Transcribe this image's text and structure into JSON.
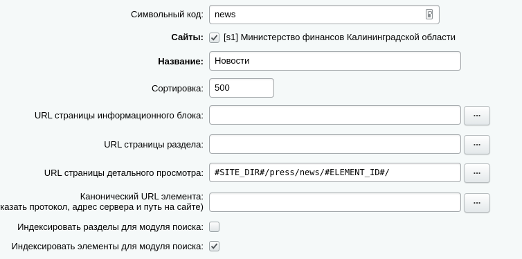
{
  "form": {
    "code": {
      "label": "Символьный код:",
      "value": "news"
    },
    "sites": {
      "label": "Сайты:",
      "checked": true,
      "option": "[s1] Министерство финансов Калининградской области"
    },
    "name": {
      "label": "Название:",
      "value": "Новости"
    },
    "sort": {
      "label": "Сортировка:",
      "value": "500"
    },
    "list_url": {
      "label": "URL страницы информационного блока:",
      "value": "",
      "button": "..."
    },
    "section_url": {
      "label": "URL страницы раздела:",
      "value": "",
      "button": "..."
    },
    "detail_url": {
      "label": "URL страницы детального просмотра:",
      "value": "#SITE_DIR#/press/news/#ELEMENT_ID#/",
      "button": "..."
    },
    "canonical_url": {
      "label_line1": "Канонический URL элемента:",
      "label_line2": "указать протокол, адрес сервера и путь на сайте)",
      "value": "",
      "button": "..."
    },
    "index_sections": {
      "label": "Индексировать разделы для модуля поиска:",
      "checked": false
    },
    "index_elements": {
      "label": "Индексировать элементы для модуля поиска:",
      "checked": true
    }
  },
  "icons": {
    "code_field": "key-icon",
    "checkmark": "check-icon"
  }
}
